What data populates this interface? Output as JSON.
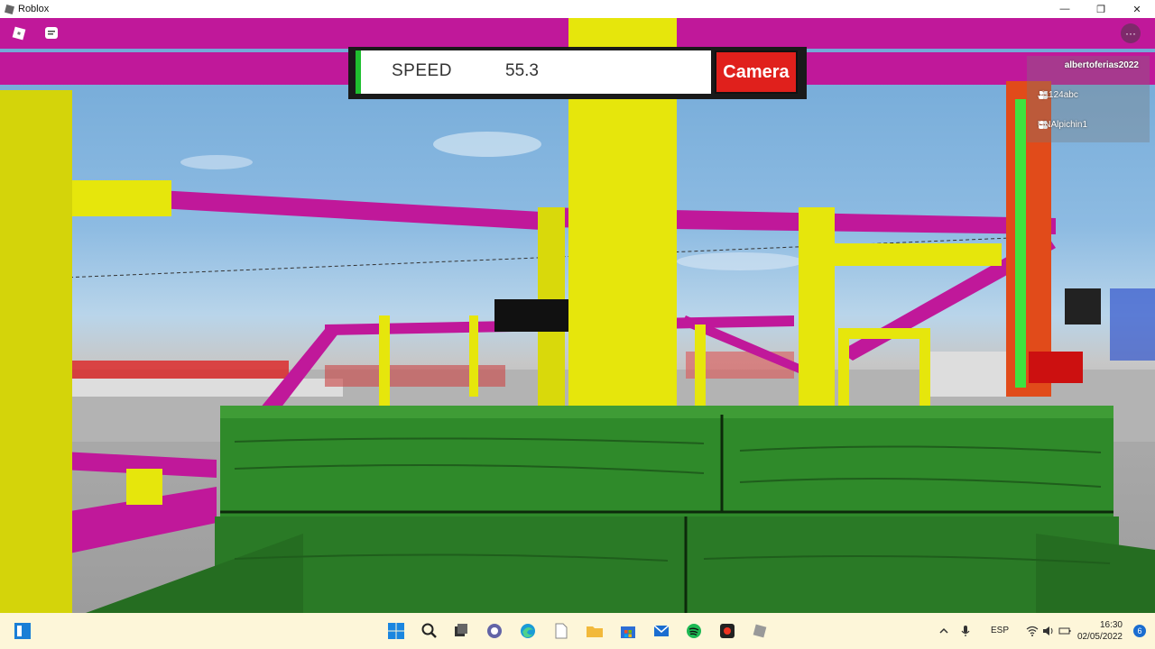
{
  "window": {
    "title": "Roblox",
    "controls": {
      "minimize": "—",
      "restore": "❐",
      "close": "✕"
    }
  },
  "hud": {
    "speed_label": "SPEED",
    "speed_value": "55.3",
    "camera_label": "Camera",
    "menu_dots": "···"
  },
  "playerlist": {
    "local_player": "albertoferias2022",
    "players": [
      "Jj1124abc",
      "UNAlpichin1"
    ]
  },
  "taskbar": {
    "language": "ESP",
    "time": "16:30",
    "date": "02/05/2022",
    "notification_count": "6"
  },
  "colors": {
    "track_magenta": "#c0189a",
    "support_yellow": "#e6e60c",
    "cart_green": "#2a7a26",
    "camera_red": "#e0201c",
    "speed_green": "#1fbf2f"
  }
}
